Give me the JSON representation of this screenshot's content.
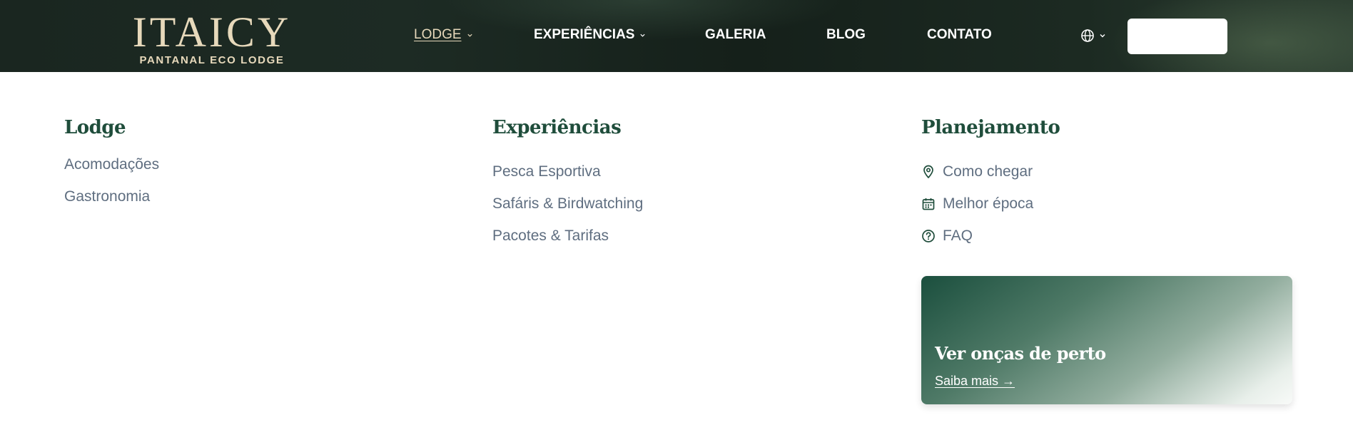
{
  "brand": {
    "name": "ITAICY",
    "tagline": "PANTANAL ECO LODGE"
  },
  "nav": {
    "items": [
      {
        "label": "LODGE",
        "has_dropdown": true,
        "active": true
      },
      {
        "label": "EXPERIÊNCIAS",
        "has_dropdown": true,
        "active": false
      },
      {
        "label": "GALERIA",
        "has_dropdown": false,
        "active": false
      },
      {
        "label": "BLOG",
        "has_dropdown": false,
        "active": false
      },
      {
        "label": "CONTATO",
        "has_dropdown": false,
        "active": false
      }
    ],
    "language_icon": "globe-icon",
    "cta_label": ""
  },
  "mega_menu": {
    "columns": [
      {
        "title": "Lodge",
        "links": [
          "Acomodações",
          "Gastronomia"
        ]
      },
      {
        "title": "Experiências",
        "links": [
          "Pesca Esportiva",
          "Safáris & Birdwatching",
          "Pacotes & Tarifas"
        ]
      },
      {
        "title": "Planejamento",
        "links": [
          {
            "label": "Como chegar",
            "icon": "map-pin-icon"
          },
          {
            "label": "Melhor época",
            "icon": "calendar-icon"
          },
          {
            "label": "FAQ",
            "icon": "help-circle-icon"
          }
        ]
      }
    ],
    "promo": {
      "title": "Ver onças de perto",
      "link_label": "Saiba mais →"
    }
  },
  "colors": {
    "header_bg": "#1a2620",
    "logo": "#e7d9bb",
    "heading": "#1f4d3b",
    "link": "#5f6e80",
    "promo_start": "#1b4f3e"
  }
}
